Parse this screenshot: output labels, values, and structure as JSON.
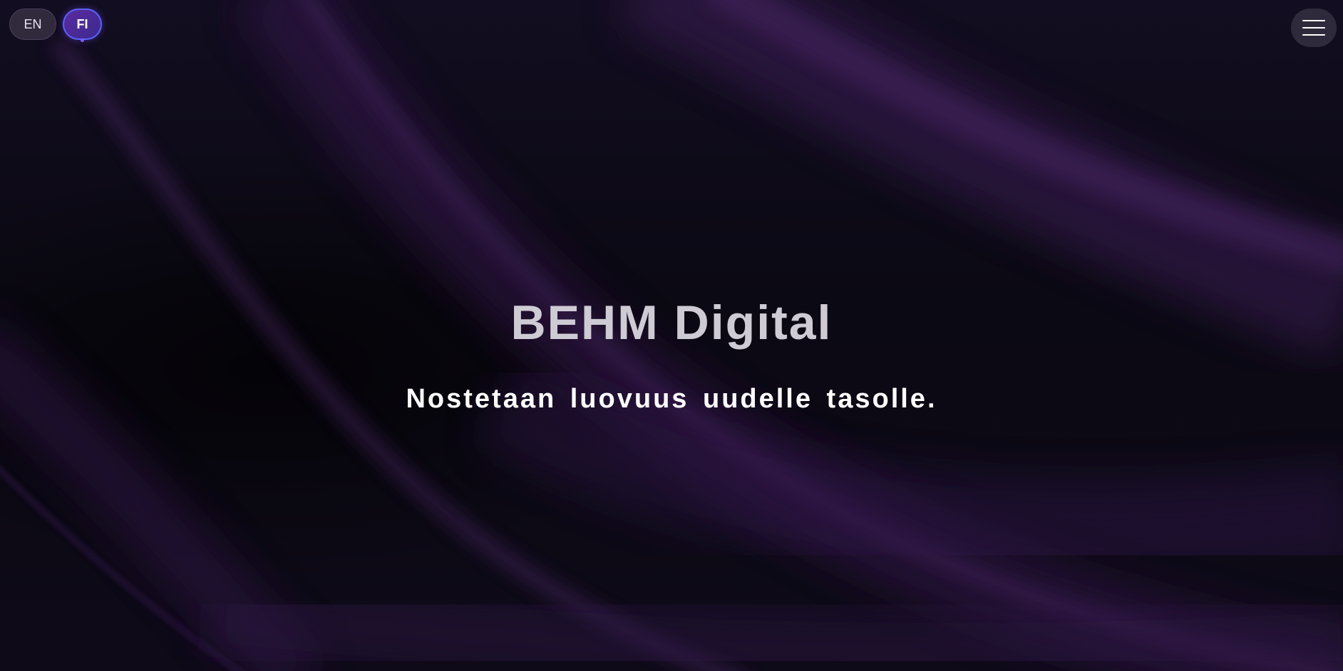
{
  "language_switcher": {
    "options": [
      {
        "code": "EN",
        "active": false
      },
      {
        "code": "FI",
        "active": true
      }
    ]
  },
  "menu": {
    "icon": "hamburger-menu-icon"
  },
  "hero": {
    "title": "BEHM Digital",
    "tagline": "Nostetaan luovuus uudelle tasolle."
  },
  "colors": {
    "background": "#0b0913",
    "accent_purple": "#5b2aa0",
    "accent_blue_border": "#5a63ff",
    "wave_purple": "#3a1f52"
  }
}
